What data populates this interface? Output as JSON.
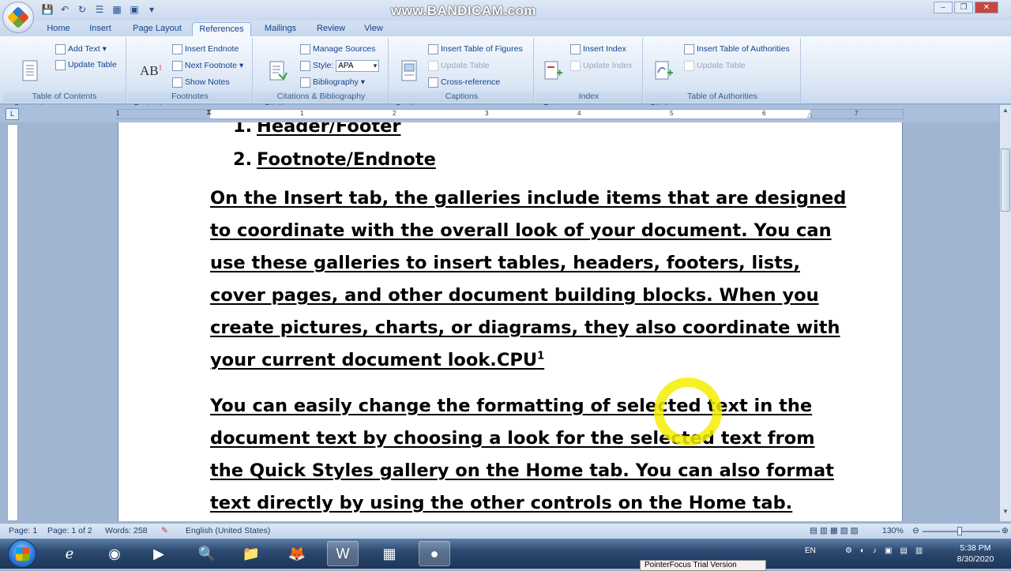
{
  "window": {
    "title": "www.BANDICAM.com",
    "controls": [
      "–",
      "❐",
      "✕"
    ]
  },
  "quick_access": [
    "save-icon",
    "undo-icon",
    "redo-icon",
    "list-icon",
    "table-icon",
    "picture-icon"
  ],
  "tabs": [
    {
      "label": "Home",
      "active": false
    },
    {
      "label": "Insert",
      "active": false
    },
    {
      "label": "Page Layout",
      "active": false
    },
    {
      "label": "References",
      "active": true
    },
    {
      "label": "Mailings",
      "active": false
    },
    {
      "label": "Review",
      "active": false
    },
    {
      "label": "View",
      "active": false
    }
  ],
  "ribbon": {
    "toc": {
      "label": "Table of Contents",
      "big": "Table of\nContents",
      "add_text": "Add Text",
      "update_table": "Update Table"
    },
    "footnotes": {
      "label": "Footnotes",
      "insert_footnote": "Insert\nFootnote",
      "insert_endnote": "Insert Endnote",
      "next_footnote": "Next Footnote",
      "show_notes": "Show Notes"
    },
    "citations": {
      "label": "Citations & Bibliography",
      "insert_citation": "Insert\nCitation",
      "manage_sources": "Manage Sources",
      "style_label": "Style:",
      "style_value": "APA",
      "bibliography": "Bibliography"
    },
    "captions": {
      "label": "Captions",
      "insert_caption": "Insert\nCaption",
      "insert_tof": "Insert Table of Figures",
      "update_table": "Update Table",
      "cross_reference": "Cross-reference"
    },
    "index": {
      "label": "Index",
      "mark_entry": "Mark\nEntry",
      "insert_index": "Insert Index",
      "update_index": "Update Index"
    },
    "authorities": {
      "label": "Table of Authorities",
      "mark_citation": "Mark\nCitation",
      "insert_toa": "Insert Table of Authorities",
      "update_table": "Update Table"
    }
  },
  "ruler": {
    "corner": "L",
    "numbers": [
      "1",
      "1",
      "2",
      "3",
      "4",
      "5",
      "6",
      "7"
    ]
  },
  "document": {
    "list": [
      {
        "num": "1.",
        "text": "Header/Footer"
      },
      {
        "num": "2.",
        "text": "Footnote/Endnote"
      }
    ],
    "para1": [
      "On the Insert tab, the galleries include items that are designed",
      "to coordinate with the overall look of your document. You can",
      "use these galleries to insert tables, headers, footers, lists,",
      "cover pages, and other document building blocks. When you",
      "create pictures, charts, or diagrams, they also coordinate with"
    ],
    "para1_last": "your current document look.CPU",
    "footnote_ref": "1",
    "para2": [
      "You can easily change the formatting of selected text in the",
      "document text by choosing a look for the selected text from",
      "the Quick Styles gallery on the Home tab. You can also format",
      "text directly by using the other controls on the Home tab."
    ]
  },
  "status": {
    "page": "Page: 1",
    "page_of": "Page: 1 of 2",
    "words": "Words: 258",
    "language": "English (United States)",
    "zoom": "130%"
  },
  "taskbar": {
    "apps": [
      "ie-icon",
      "chrome-icon",
      "media-icon",
      "search-icon",
      "folder-icon",
      "firefox-icon",
      "word-icon",
      "calculator-icon",
      "bandicam-icon"
    ],
    "tray_lang": "EN",
    "time": "5:38 PM",
    "date": "8/30/2020",
    "popup": "PointerFocus Trial Version"
  }
}
